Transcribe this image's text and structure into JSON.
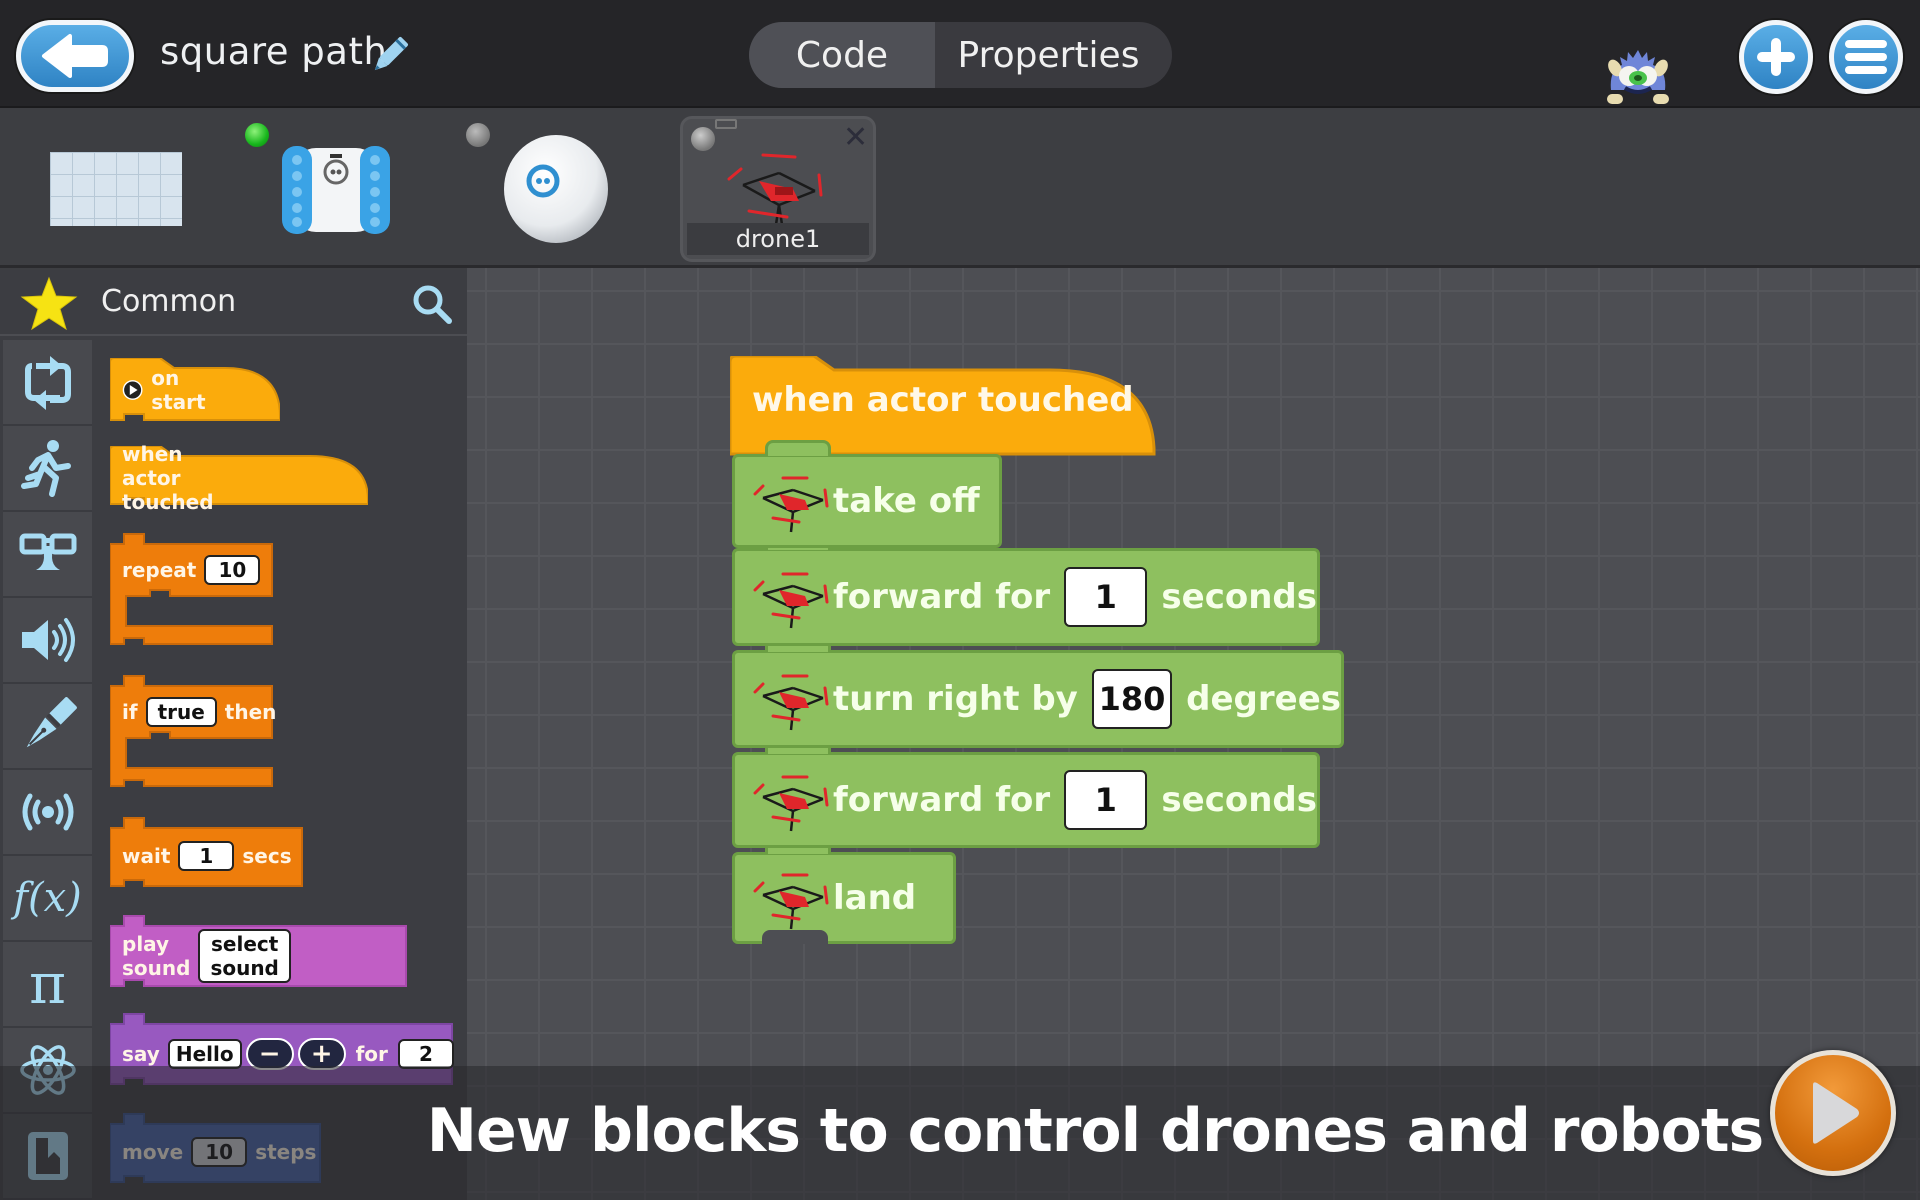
{
  "header": {
    "back_icon": "arrow-left-icon",
    "project_title": "square path",
    "edit_icon": "pencil-icon",
    "tabs": [
      {
        "label": "Code",
        "active": true
      },
      {
        "label": "Properties",
        "active": false
      }
    ],
    "mascot": "monster-mascot",
    "add_icon": "plus-icon",
    "menu_icon": "hamburger-menu-icon"
  },
  "actors": [
    {
      "name": "stage",
      "type": "stage-grid"
    },
    {
      "name": "Ollie",
      "type": "robot",
      "status": "connected",
      "status_color": "#1fbf22"
    },
    {
      "name": "Sphero",
      "type": "robot",
      "status": "disconnected",
      "status_color": "#888888"
    },
    {
      "name": "drone1",
      "type": "drone",
      "status": "disconnected",
      "selected": true,
      "close_icon": "close-icon"
    }
  ],
  "palette": {
    "title": "Common",
    "search_icon": "search-icon",
    "categories": [
      {
        "name": "common",
        "icon": "star-icon"
      },
      {
        "name": "control",
        "icon": "loop-icon"
      },
      {
        "name": "motion",
        "icon": "running-person-icon"
      },
      {
        "name": "looks",
        "icon": "disguise-glasses-icon"
      },
      {
        "name": "sound",
        "icon": "speaker-icon"
      },
      {
        "name": "pen",
        "icon": "fountain-pen-icon"
      },
      {
        "name": "sensing",
        "icon": "broadcast-icon"
      },
      {
        "name": "functions",
        "icon": "function-icon",
        "glyph": "f(x)"
      },
      {
        "name": "math",
        "icon": "pi-icon",
        "glyph": "π"
      },
      {
        "name": "science",
        "icon": "atom-icon"
      },
      {
        "name": "variables",
        "icon": "bookmark-book-icon"
      }
    ],
    "blocks": {
      "on_start": {
        "label": "on start"
      },
      "when_touched": {
        "label": "when actor touched"
      },
      "repeat": {
        "label": "repeat",
        "value": "10"
      },
      "if": {
        "label_if": "if",
        "value": "true",
        "label_then": "then"
      },
      "wait": {
        "label": "wait",
        "value": "1",
        "unit": "secs"
      },
      "play_sound": {
        "label": "play sound",
        "value": "select sound"
      },
      "say": {
        "label": "say",
        "value": "Hello",
        "minus": "−",
        "plus": "+",
        "for": "for",
        "duration": "2"
      },
      "move": {
        "label": "move",
        "value": "10",
        "unit": "steps"
      }
    },
    "colors": {
      "event": "#fbab0c",
      "control": "#ee7d0b",
      "sound": "#c15ec5",
      "looks": "#9859c0",
      "motion": "#4563a9"
    }
  },
  "script": {
    "hat": "when actor touched",
    "blocks": [
      {
        "label": "take off"
      },
      {
        "label": "forward for",
        "value": "1",
        "unit": "seconds"
      },
      {
        "label": "turn right by",
        "value": "180",
        "unit": "degrees"
      },
      {
        "label": "forward for",
        "value": "1",
        "unit": "seconds"
      },
      {
        "label": "land"
      }
    ],
    "block_color": "#8ec05f"
  },
  "caption": "New blocks to control drones and robots",
  "run_icon": "play-icon"
}
